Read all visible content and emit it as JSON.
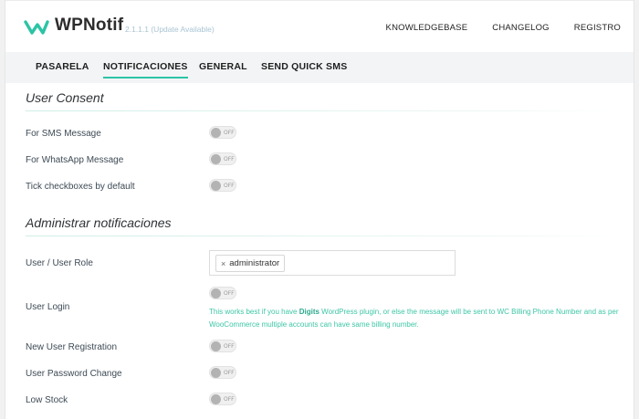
{
  "header": {
    "brand": "WPNotif",
    "version": "2.1.1.1 (Update Available)",
    "nav": [
      "KNOWLEDGEBASE",
      "CHANGELOG",
      "REGISTRO"
    ]
  },
  "tabs": [
    {
      "label": "PASARELA",
      "active": false
    },
    {
      "label": "NOTIFICACIONES",
      "active": true
    },
    {
      "label": "GENERAL",
      "active": false
    },
    {
      "label": "SEND QUICK SMS",
      "active": false
    }
  ],
  "user_consent": {
    "title": "User Consent",
    "rows": [
      {
        "label": "For SMS Message",
        "toggle": "OFF"
      },
      {
        "label": "For WhatsApp Message",
        "toggle": "OFF"
      },
      {
        "label": "Tick checkboxes by default",
        "toggle": "OFF"
      }
    ]
  },
  "admin_notifications": {
    "title": "Administrar notificaciones",
    "user_role": {
      "label": "User / User Role",
      "remove_glyph": "×",
      "selected": "administrator"
    },
    "user_login": {
      "label": "User Login",
      "toggle": "OFF",
      "hint_before": "This works best if you have ",
      "hint_bold": "Digits",
      "hint_after": " WordPress plugin, or else the message will be sent to WC Billing Phone Number and as per WooCommerce multiple accounts can have same billing number."
    },
    "rows": [
      {
        "label": "New User Registration",
        "toggle": "OFF"
      },
      {
        "label": "User Password Change",
        "toggle": "OFF"
      },
      {
        "label": "Low Stock",
        "toggle": "OFF"
      }
    ]
  },
  "colors": {
    "accent": "#2bc4a5",
    "hint_text": "#3ec6a7",
    "tab_bar": "#f3f4f6"
  },
  "icons": {
    "logo": "wpnotif-logo-icon",
    "remove": "close-icon"
  }
}
